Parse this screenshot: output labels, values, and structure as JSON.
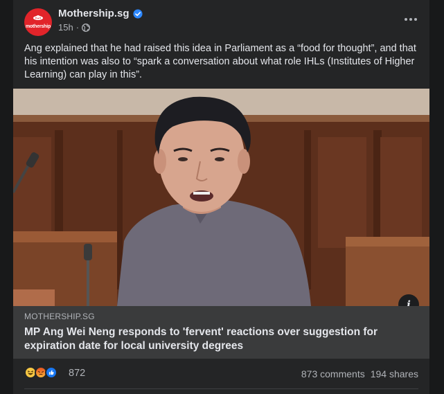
{
  "post": {
    "page_name": "Mothership.sg",
    "avatar_text": "mothership",
    "time": "15h",
    "meta_sep": "·",
    "caption": "Ang explained that he had raised this idea in Parliament as a “food for thought”, and that his intention was also to “spark a conversation about what role IHLs (Institutes of Higher Learning) can play in this”."
  },
  "link": {
    "domain": "MOTHERSHIP.SG",
    "title": "MP Ang Wei Neng responds to 'fervent' reactions over suggestion for expiration date for local university degrees",
    "info_label": "i"
  },
  "engagement": {
    "reaction_count": "872",
    "comments": "873 comments",
    "shares": "194 shares"
  },
  "colors": {
    "card_bg": "#242526",
    "page_bg": "#18191a",
    "preview_bg": "#3a3b3c",
    "brand_red": "#e1242a",
    "verified_blue": "#2d88ff"
  },
  "icons": [
    "verified-badge-icon",
    "globe-icon",
    "more-options-icon",
    "info-icon",
    "haha-reaction-icon",
    "angry-reaction-icon",
    "like-reaction-icon"
  ]
}
